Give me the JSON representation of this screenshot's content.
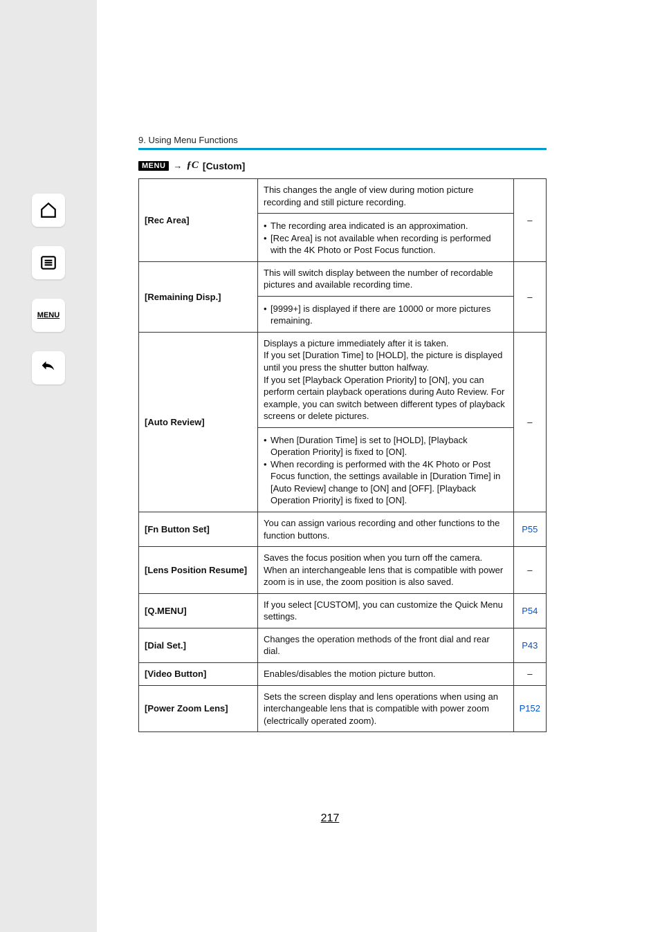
{
  "chapter": "9. Using Menu Functions",
  "menu_path": {
    "menu_label": "MENU",
    "arrow": "→",
    "fc": "ƒC",
    "custom": "[Custom]"
  },
  "rows": {
    "rec_area": {
      "label": "[Rec Area]",
      "desc": "This changes the angle of view during motion picture recording and still picture recording.",
      "b1": "The recording area indicated is an approximation.",
      "b2": "[Rec Area] is not available when recording is performed with the 4K Photo or Post Focus function.",
      "ref": "–"
    },
    "remaining": {
      "label": "[Remaining Disp.]",
      "desc": "This will switch display between the number of recordable pictures and available recording time.",
      "b1": "[9999+] is displayed if there are 10000 or more pictures remaining.",
      "ref": "–"
    },
    "auto_review": {
      "label": "[Auto Review]",
      "desc": "Displays a picture immediately after it is taken.\nIf you set [Duration Time] to [HOLD], the picture is displayed until you press the shutter button halfway.\nIf you set [Playback Operation Priority] to [ON], you can perform certain playback operations during Auto Review. For example, you can switch between different types of playback screens or delete pictures.",
      "b1": "When [Duration Time] is set to [HOLD], [Playback Operation Priority] is fixed to [ON].",
      "b2": "When recording is performed with the 4K Photo or Post Focus function, the settings available in [Duration Time] in [Auto Review] change to [ON] and [OFF]. [Playback Operation Priority] is fixed to [ON].",
      "ref": "–"
    },
    "fn_button": {
      "label": "[Fn Button Set]",
      "desc": "You can assign various recording and other functions to the function buttons.",
      "ref": "P55"
    },
    "lens_pos": {
      "label": "[Lens Position Resume]",
      "desc": "Saves the focus position when you turn off the camera. When an interchangeable lens that is compatible with power zoom is in use, the zoom position is also saved.",
      "ref": "–"
    },
    "qmenu": {
      "label": "[Q.MENU]",
      "desc": "If you select [CUSTOM], you can customize the Quick Menu settings.",
      "ref": "P54"
    },
    "dial_set": {
      "label": "[Dial Set.]",
      "desc": "Changes the operation methods of the front dial and rear dial.",
      "ref": "P43"
    },
    "video_btn": {
      "label": "[Video Button]",
      "desc": "Enables/disables the motion picture button.",
      "ref": "–"
    },
    "power_zoom": {
      "label": "[Power Zoom Lens]",
      "desc": "Sets the screen display and lens operations when using an interchangeable lens that is compatible with power zoom (electrically operated zoom).",
      "ref": "P152"
    }
  },
  "page_number": "217"
}
